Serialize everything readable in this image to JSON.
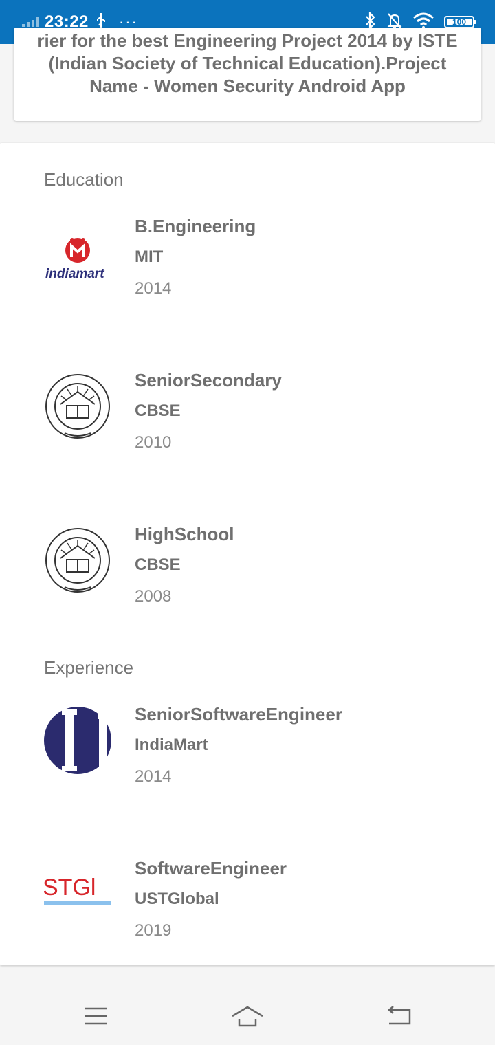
{
  "status_bar": {
    "time": "23:22",
    "battery": "100",
    "icons": [
      "signal-icon",
      "usb-icon",
      "more-icon",
      "bluetooth-icon",
      "mute-icon",
      "wifi-icon",
      "battery-icon"
    ]
  },
  "award_card": {
    "text": "rier for the best Engineering Project 2014 by ISTE (Indian Society of Technical Education).Project Name - Women Security Android App"
  },
  "education": {
    "title": "Education",
    "items": [
      {
        "title": "B.Engineering",
        "org": "MIT",
        "year": "2014",
        "logo": "indiamart"
      },
      {
        "title": "SeniorSecondary",
        "org": "CBSE",
        "year": "2010",
        "logo": "cbse-seal"
      },
      {
        "title": "HighSchool",
        "org": "CBSE",
        "year": "2008",
        "logo": "cbse-seal"
      }
    ]
  },
  "experience": {
    "title": "Experience",
    "items": [
      {
        "title": "SeniorSoftwareEngineer",
        "org": "IndiaMart",
        "year": "2014",
        "logo": "ii-logo"
      },
      {
        "title": "SoftwareEngineer",
        "org": "USTGlobal",
        "year": "2019",
        "logo": "ust-global"
      }
    ]
  },
  "logos": {
    "indiamart_text": "indiamart",
    "ust_text": "STGl"
  },
  "nav": [
    "menu-icon",
    "home-icon",
    "back-icon"
  ],
  "colors": {
    "status_bar": "#0b73bd",
    "text_dark": "#6f6f6f",
    "text_light": "#8a8a8a",
    "indiamart_red": "#d7262b",
    "indiamart_blue": "#2c2f7a"
  }
}
